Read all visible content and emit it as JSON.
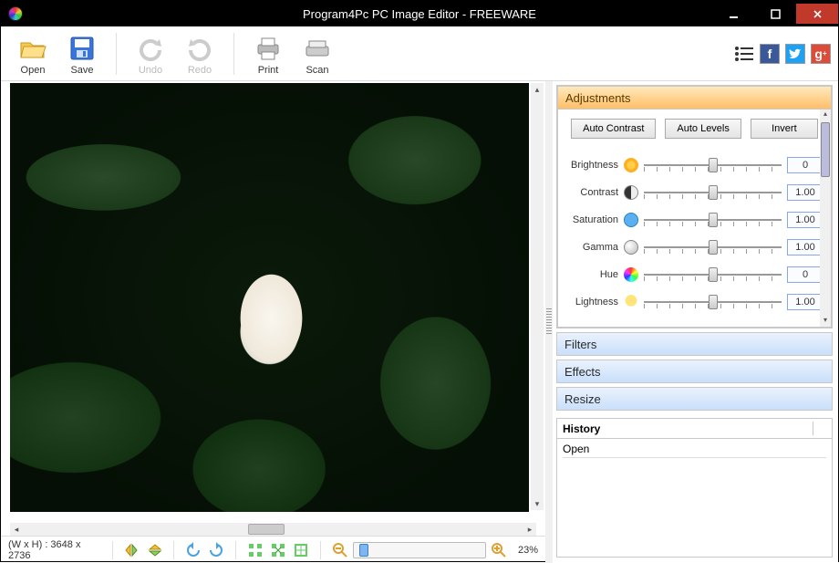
{
  "window": {
    "title": "Program4Pc PC Image Editor - FREEWARE"
  },
  "toolbar": {
    "open": "Open",
    "save": "Save",
    "undo": "Undo",
    "redo": "Redo",
    "print": "Print",
    "scan": "Scan"
  },
  "panels": {
    "adjustments": {
      "title": "Adjustments",
      "buttons": {
        "auto_contrast": "Auto Contrast",
        "auto_levels": "Auto Levels",
        "invert": "Invert"
      },
      "sliders": {
        "brightness": {
          "label": "Brightness",
          "value": "0"
        },
        "contrast": {
          "label": "Contrast",
          "value": "1.00"
        },
        "saturation": {
          "label": "Saturation",
          "value": "1.00"
        },
        "gamma": {
          "label": "Gamma",
          "value": "1.00"
        },
        "hue": {
          "label": "Hue",
          "value": "0"
        },
        "lightness": {
          "label": "Lightness",
          "value": "1.00"
        }
      }
    },
    "filters": "Filters",
    "effects": "Effects",
    "resize": "Resize"
  },
  "history": {
    "title": "History",
    "items": [
      "Open"
    ]
  },
  "status": {
    "dimensions": "(W x H) : 3648 x 2736",
    "zoom": "23%"
  }
}
